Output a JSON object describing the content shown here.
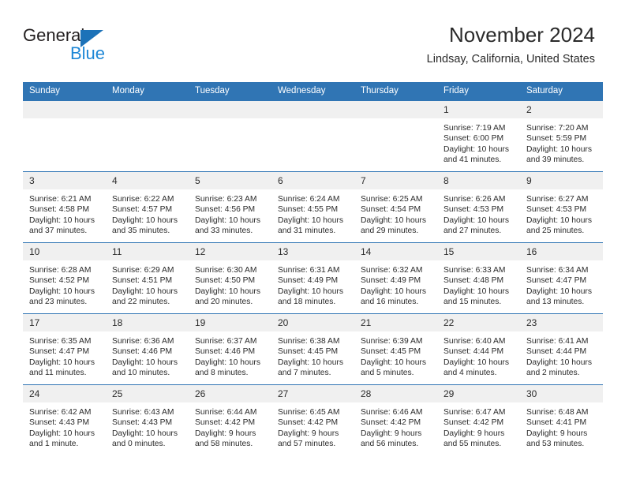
{
  "brand": {
    "word_one": "General",
    "word_two": "Blue",
    "triangle_icon": "brand-triangle-icon",
    "accent_color": "#1e87d6",
    "triangle_color": "#1c72b8"
  },
  "header": {
    "title": "November 2024",
    "location": "Lindsay, California, United States"
  },
  "calendar": {
    "header_bg": "#3075b4",
    "daynum_bg": "#f0f0f0",
    "weekday_headers": [
      "Sunday",
      "Monday",
      "Tuesday",
      "Wednesday",
      "Thursday",
      "Friday",
      "Saturday"
    ],
    "weeks": [
      [
        {
          "day": "",
          "lines": []
        },
        {
          "day": "",
          "lines": []
        },
        {
          "day": "",
          "lines": []
        },
        {
          "day": "",
          "lines": []
        },
        {
          "day": "",
          "lines": []
        },
        {
          "day": "1",
          "lines": [
            "Sunrise: 7:19 AM",
            "Sunset: 6:00 PM",
            "Daylight: 10 hours",
            "and 41 minutes."
          ]
        },
        {
          "day": "2",
          "lines": [
            "Sunrise: 7:20 AM",
            "Sunset: 5:59 PM",
            "Daylight: 10 hours",
            "and 39 minutes."
          ]
        }
      ],
      [
        {
          "day": "3",
          "lines": [
            "Sunrise: 6:21 AM",
            "Sunset: 4:58 PM",
            "Daylight: 10 hours",
            "and 37 minutes."
          ]
        },
        {
          "day": "4",
          "lines": [
            "Sunrise: 6:22 AM",
            "Sunset: 4:57 PM",
            "Daylight: 10 hours",
            "and 35 minutes."
          ]
        },
        {
          "day": "5",
          "lines": [
            "Sunrise: 6:23 AM",
            "Sunset: 4:56 PM",
            "Daylight: 10 hours",
            "and 33 minutes."
          ]
        },
        {
          "day": "6",
          "lines": [
            "Sunrise: 6:24 AM",
            "Sunset: 4:55 PM",
            "Daylight: 10 hours",
            "and 31 minutes."
          ]
        },
        {
          "day": "7",
          "lines": [
            "Sunrise: 6:25 AM",
            "Sunset: 4:54 PM",
            "Daylight: 10 hours",
            "and 29 minutes."
          ]
        },
        {
          "day": "8",
          "lines": [
            "Sunrise: 6:26 AM",
            "Sunset: 4:53 PM",
            "Daylight: 10 hours",
            "and 27 minutes."
          ]
        },
        {
          "day": "9",
          "lines": [
            "Sunrise: 6:27 AM",
            "Sunset: 4:53 PM",
            "Daylight: 10 hours",
            "and 25 minutes."
          ]
        }
      ],
      [
        {
          "day": "10",
          "lines": [
            "Sunrise: 6:28 AM",
            "Sunset: 4:52 PM",
            "Daylight: 10 hours",
            "and 23 minutes."
          ]
        },
        {
          "day": "11",
          "lines": [
            "Sunrise: 6:29 AM",
            "Sunset: 4:51 PM",
            "Daylight: 10 hours",
            "and 22 minutes."
          ]
        },
        {
          "day": "12",
          "lines": [
            "Sunrise: 6:30 AM",
            "Sunset: 4:50 PM",
            "Daylight: 10 hours",
            "and 20 minutes."
          ]
        },
        {
          "day": "13",
          "lines": [
            "Sunrise: 6:31 AM",
            "Sunset: 4:49 PM",
            "Daylight: 10 hours",
            "and 18 minutes."
          ]
        },
        {
          "day": "14",
          "lines": [
            "Sunrise: 6:32 AM",
            "Sunset: 4:49 PM",
            "Daylight: 10 hours",
            "and 16 minutes."
          ]
        },
        {
          "day": "15",
          "lines": [
            "Sunrise: 6:33 AM",
            "Sunset: 4:48 PM",
            "Daylight: 10 hours",
            "and 15 minutes."
          ]
        },
        {
          "day": "16",
          "lines": [
            "Sunrise: 6:34 AM",
            "Sunset: 4:47 PM",
            "Daylight: 10 hours",
            "and 13 minutes."
          ]
        }
      ],
      [
        {
          "day": "17",
          "lines": [
            "Sunrise: 6:35 AM",
            "Sunset: 4:47 PM",
            "Daylight: 10 hours",
            "and 11 minutes."
          ]
        },
        {
          "day": "18",
          "lines": [
            "Sunrise: 6:36 AM",
            "Sunset: 4:46 PM",
            "Daylight: 10 hours",
            "and 10 minutes."
          ]
        },
        {
          "day": "19",
          "lines": [
            "Sunrise: 6:37 AM",
            "Sunset: 4:46 PM",
            "Daylight: 10 hours",
            "and 8 minutes."
          ]
        },
        {
          "day": "20",
          "lines": [
            "Sunrise: 6:38 AM",
            "Sunset: 4:45 PM",
            "Daylight: 10 hours",
            "and 7 minutes."
          ]
        },
        {
          "day": "21",
          "lines": [
            "Sunrise: 6:39 AM",
            "Sunset: 4:45 PM",
            "Daylight: 10 hours",
            "and 5 minutes."
          ]
        },
        {
          "day": "22",
          "lines": [
            "Sunrise: 6:40 AM",
            "Sunset: 4:44 PM",
            "Daylight: 10 hours",
            "and 4 minutes."
          ]
        },
        {
          "day": "23",
          "lines": [
            "Sunrise: 6:41 AM",
            "Sunset: 4:44 PM",
            "Daylight: 10 hours",
            "and 2 minutes."
          ]
        }
      ],
      [
        {
          "day": "24",
          "lines": [
            "Sunrise: 6:42 AM",
            "Sunset: 4:43 PM",
            "Daylight: 10 hours",
            "and 1 minute."
          ]
        },
        {
          "day": "25",
          "lines": [
            "Sunrise: 6:43 AM",
            "Sunset: 4:43 PM",
            "Daylight: 10 hours",
            "and 0 minutes."
          ]
        },
        {
          "day": "26",
          "lines": [
            "Sunrise: 6:44 AM",
            "Sunset: 4:42 PM",
            "Daylight: 9 hours",
            "and 58 minutes."
          ]
        },
        {
          "day": "27",
          "lines": [
            "Sunrise: 6:45 AM",
            "Sunset: 4:42 PM",
            "Daylight: 9 hours",
            "and 57 minutes."
          ]
        },
        {
          "day": "28",
          "lines": [
            "Sunrise: 6:46 AM",
            "Sunset: 4:42 PM",
            "Daylight: 9 hours",
            "and 56 minutes."
          ]
        },
        {
          "day": "29",
          "lines": [
            "Sunrise: 6:47 AM",
            "Sunset: 4:42 PM",
            "Daylight: 9 hours",
            "and 55 minutes."
          ]
        },
        {
          "day": "30",
          "lines": [
            "Sunrise: 6:48 AM",
            "Sunset: 4:41 PM",
            "Daylight: 9 hours",
            "and 53 minutes."
          ]
        }
      ]
    ]
  }
}
